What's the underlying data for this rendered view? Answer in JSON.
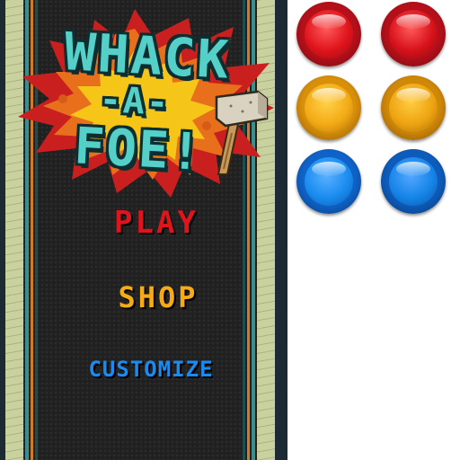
{
  "logo": {
    "line1": "WHACK",
    "line2": "-A-",
    "line3": "FOE!"
  },
  "menu": {
    "play": "PLAY",
    "shop": "SHOP",
    "customize": "CUSTOMIZE"
  },
  "colors": {
    "play": "#e0141c",
    "shop": "#f4ab16",
    "customize": "#1a8cf0",
    "logo_text": "#55d0c8",
    "background": "#202020"
  },
  "buttons": [
    {
      "color": "red",
      "row": 1,
      "col": 1
    },
    {
      "color": "red",
      "row": 1,
      "col": 2
    },
    {
      "color": "yellow",
      "row": 2,
      "col": 1
    },
    {
      "color": "yellow",
      "row": 2,
      "col": 2
    },
    {
      "color": "blue",
      "row": 3,
      "col": 1
    },
    {
      "color": "blue",
      "row": 3,
      "col": 2
    }
  ]
}
